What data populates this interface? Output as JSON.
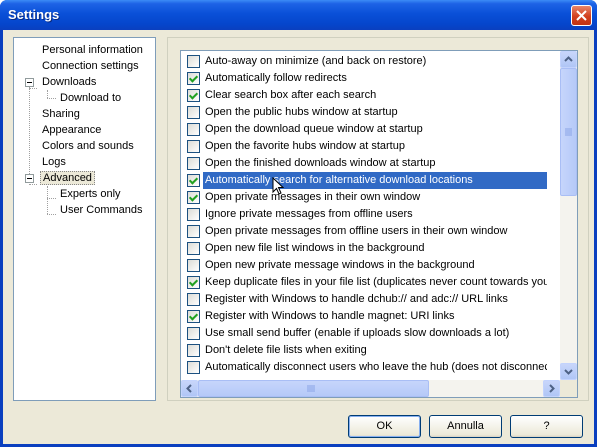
{
  "window": {
    "title": "Settings"
  },
  "tree": {
    "items": [
      {
        "label": "Personal information",
        "level": 0
      },
      {
        "label": "Connection settings",
        "level": 0
      },
      {
        "label": "Downloads",
        "level": 0,
        "expanded": true
      },
      {
        "label": "Download to",
        "level": 1
      },
      {
        "label": "Sharing",
        "level": 0
      },
      {
        "label": "Appearance",
        "level": 0,
        "expanded": true
      },
      {
        "label": "Colors and sounds",
        "level": 1
      },
      {
        "label": "Logs",
        "level": 0
      },
      {
        "label": "Advanced",
        "level": 0,
        "expanded": true,
        "selected": true
      },
      {
        "label": "Experts only",
        "level": 1
      },
      {
        "label": "User Commands",
        "level": 1
      }
    ]
  },
  "options": [
    {
      "label": "Auto-away on minimize (and back on restore)",
      "checked": false
    },
    {
      "label": "Automatically follow redirects",
      "checked": true
    },
    {
      "label": "Clear search box after each search",
      "checked": true
    },
    {
      "label": "Open the public hubs window at startup",
      "checked": false
    },
    {
      "label": "Open the download queue window at startup",
      "checked": false
    },
    {
      "label": "Open the favorite hubs window at startup",
      "checked": false
    },
    {
      "label": "Open the finished downloads window at startup",
      "checked": false
    },
    {
      "label": "Automatically search for alternative download locations",
      "checked": true,
      "selected": true
    },
    {
      "label": "Open private messages in their own window",
      "checked": true
    },
    {
      "label": "Ignore private messages from offline users",
      "checked": false
    },
    {
      "label": "Open private messages from offline users in their own window",
      "checked": false
    },
    {
      "label": "Open new file list windows in the background",
      "checked": false
    },
    {
      "label": "Open new private message windows in the background",
      "checked": false
    },
    {
      "label": "Keep duplicate files in your file list (duplicates never count towards your sh",
      "checked": true
    },
    {
      "label": "Register with Windows to handle dchub:// and adc:// URL links",
      "checked": false
    },
    {
      "label": "Register with Windows to handle magnet: URI links",
      "checked": true
    },
    {
      "label": "Use small send buffer (enable if uploads slow downloads a lot)",
      "checked": false
    },
    {
      "label": "Don't delete file lists when exiting",
      "checked": false
    },
    {
      "label": "Automatically disconnect users who leave the hub (does not disconnect w",
      "checked": false
    }
  ],
  "buttons": {
    "ok": "OK",
    "cancel": "Annulla",
    "help": "?"
  }
}
